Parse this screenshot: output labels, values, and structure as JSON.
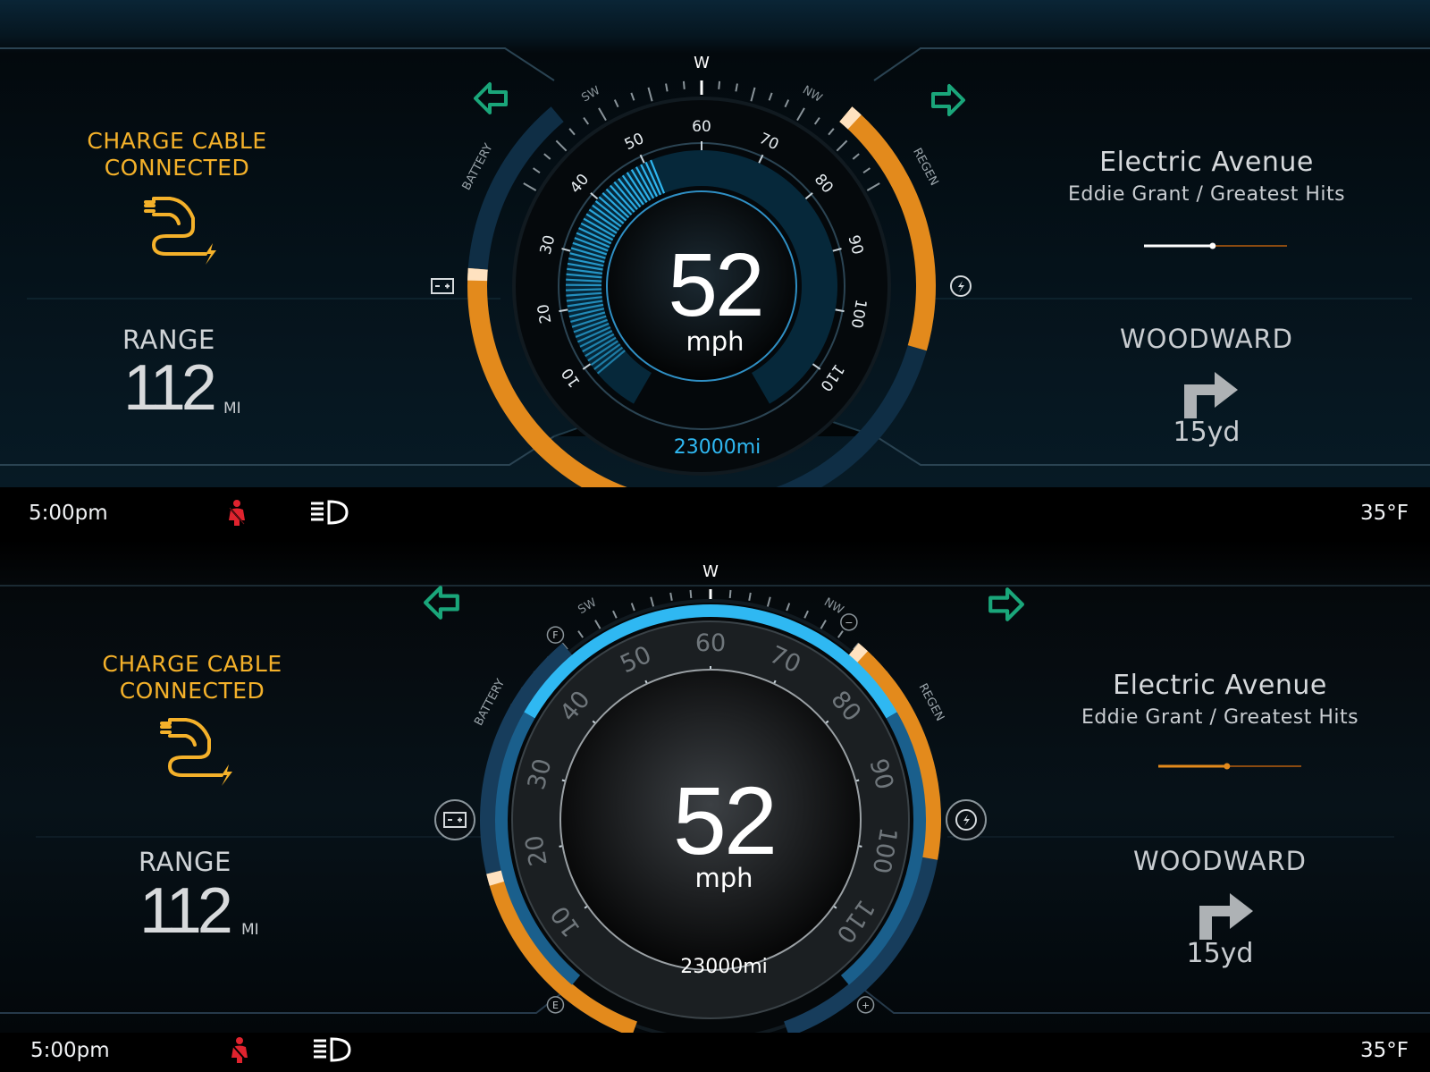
{
  "colors": {
    "accent_amber": "#f4b12a",
    "accent_blue": "#2fb8f2",
    "turn_signal_green": "#1aa67a",
    "warning_red": "#e0232e",
    "regen_orange": "#e38a1c"
  },
  "clusters": [
    {
      "variant": "top",
      "alert": {
        "line1": "CHARGE CABLE",
        "line2": "CONNECTED",
        "icon": "charge-cable-icon"
      },
      "range": {
        "label": "RANGE",
        "value": "112",
        "unit": "MI"
      },
      "gauge": {
        "speed": "52",
        "speed_unit": "mph",
        "odometer": "23000mi",
        "speed_ticks": [
          "10",
          "20",
          "30",
          "40",
          "50",
          "60",
          "70",
          "80",
          "90",
          "100",
          "110"
        ],
        "compass": {
          "heading": "W",
          "left": "SW",
          "right": "NW"
        },
        "battery_label": "BATTERY",
        "regen_label": "REGEN",
        "battery_level": 0.62,
        "regen_level": 0.55
      },
      "media": {
        "song": "Electric Avenue",
        "artist_album": "Eddie Grant / Greatest Hits",
        "progress": 0.48
      },
      "navigation": {
        "street": "WOODWARD",
        "distance": "15yd",
        "maneuver": "turn-right-icon"
      }
    },
    {
      "variant": "bottom",
      "alert": {
        "line1": "CHARGE CABLE",
        "line2": "CONNECTED",
        "icon": "charge-cable-icon"
      },
      "range": {
        "label": "RANGE",
        "value": "112",
        "unit": "MI"
      },
      "gauge": {
        "speed": "52",
        "speed_unit": "mph",
        "odometer": "23000mi",
        "speed_ticks": [
          "10",
          "20",
          "30",
          "40",
          "50",
          "60",
          "70",
          "80",
          "90",
          "100",
          "110"
        ],
        "compass": {
          "heading": "W",
          "left": "SW",
          "right": "NW"
        },
        "battery_label": "BATTERY",
        "regen_label": "REGEN",
        "battery_full_marker": "F",
        "battery_empty_marker": "E",
        "regen_minus_marker": "−",
        "regen_plus_marker": "+",
        "battery_level": 0.47,
        "regen_level": 0.5
      },
      "media": {
        "song": "Electric Avenue",
        "artist_album": "Eddie Grant / Greatest Hits",
        "progress": 0.48
      },
      "navigation": {
        "street": "WOODWARD",
        "distance": "15yd",
        "maneuver": "turn-right-icon"
      }
    }
  ],
  "status": [
    {
      "time": "5:00pm",
      "temperature": "35°F",
      "icons": [
        "seatbelt-warning-icon",
        "headlight-icon"
      ]
    },
    {
      "time": "5:00pm",
      "temperature": "35°F",
      "icons": [
        "seatbelt-warning-icon",
        "headlight-icon"
      ]
    }
  ]
}
